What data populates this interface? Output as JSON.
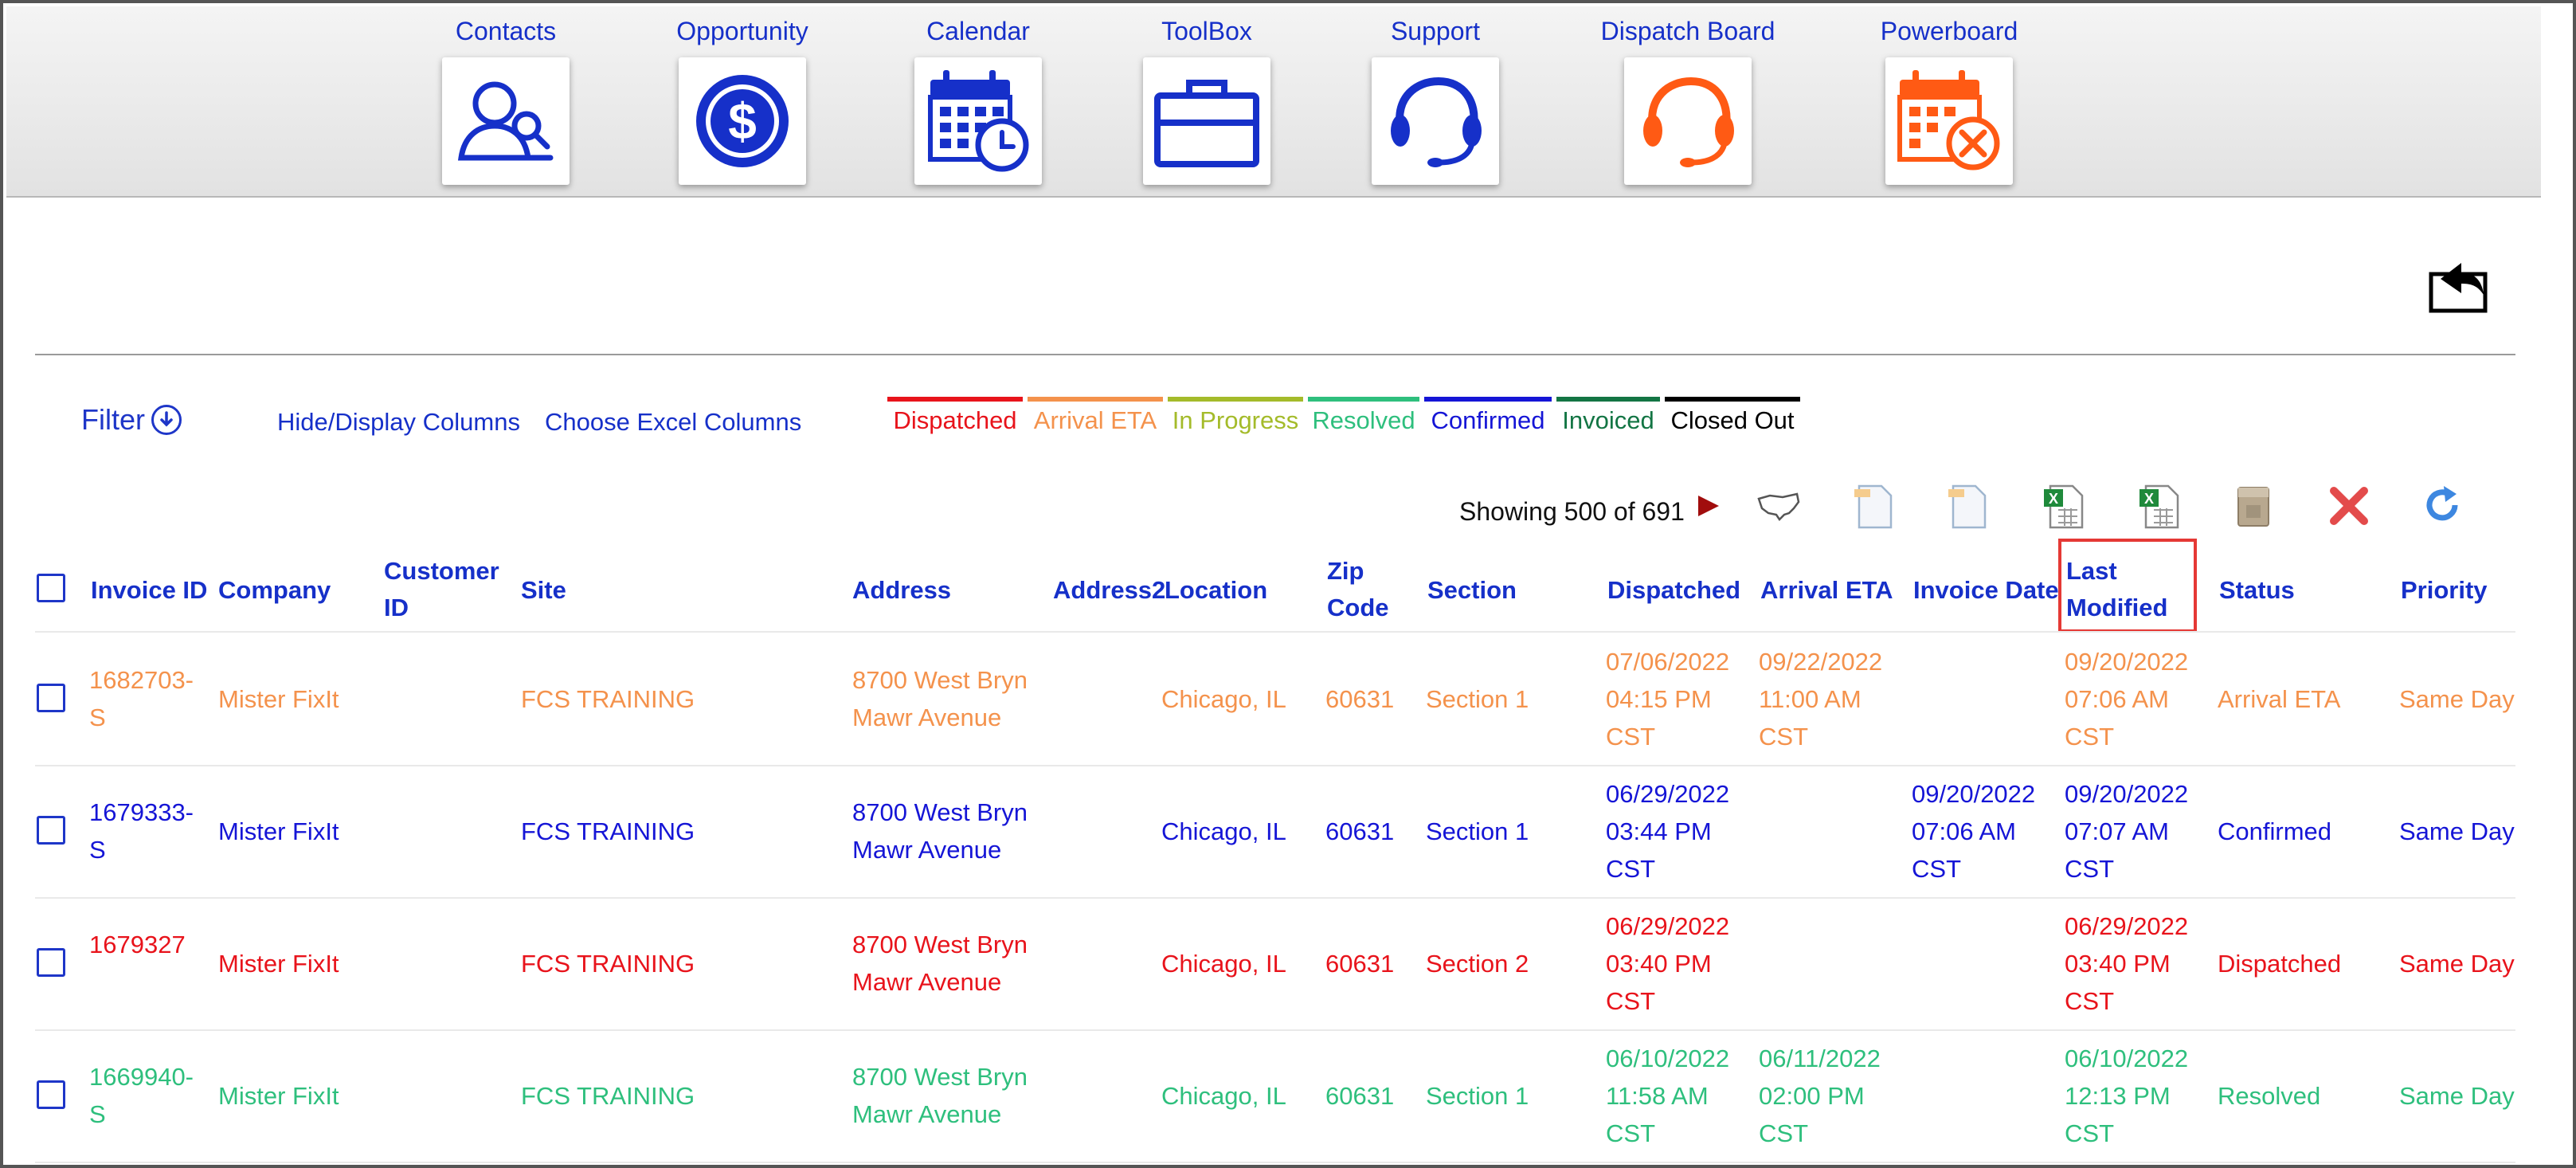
{
  "nav": [
    {
      "label": "Contacts",
      "icon": "contacts-icon",
      "color": "#1630c9"
    },
    {
      "label": "Opportunity",
      "icon": "dollar-icon",
      "color": "#1630c9"
    },
    {
      "label": "Calendar",
      "icon": "calendar-clock-icon",
      "color": "#1630c9"
    },
    {
      "label": "ToolBox",
      "icon": "briefcase-icon",
      "color": "#1630c9"
    },
    {
      "label": "Support",
      "icon": "headset-icon",
      "color": "#1630c9"
    },
    {
      "label": "Dispatch Board",
      "icon": "headset-orange-icon",
      "color": "#ff5a14"
    },
    {
      "label": "Powerboard",
      "icon": "calendar-tools-icon",
      "color": "#ff5a14"
    }
  ],
  "toolbar": {
    "filter_label": "Filter",
    "hide_display_columns": "Hide/Display Columns",
    "choose_excel_columns": "Choose Excel Columns",
    "showing_text": "Showing 500 of 691"
  },
  "legend": [
    {
      "label": "Dispatched",
      "color": "#e8131b"
    },
    {
      "label": "Arrival ETA",
      "color": "#f4924c"
    },
    {
      "label": "In Progress",
      "color": "#a4bb2a"
    },
    {
      "label": "Resolved",
      "color": "#2ebf7d"
    },
    {
      "label": "Confirmed",
      "color": "#1515d6"
    },
    {
      "label": "Invoiced",
      "color": "#137544"
    },
    {
      "label": "Closed Out",
      "color": "#000000"
    }
  ],
  "table": {
    "headers": {
      "invoice_id": "Invoice ID",
      "company": "Company",
      "customer_id": "Customer ID",
      "site": "Site",
      "address": "Address",
      "address2": "Address2",
      "location": "Location",
      "zip_code": "Zip Code",
      "section": "Section",
      "dispatched": "Dispatched",
      "arrival_eta": "Arrival ETA",
      "invoice_date": "Invoice Date",
      "last_modified": "Last Modified",
      "status": "Status",
      "priority": "Priority"
    },
    "rows": [
      {
        "color": "#f4924c",
        "invoice_id": "1682703-S",
        "company": "Mister FixIt",
        "customer_id": "",
        "site": "FCS TRAINING",
        "address": "8700 West Bryn Mawr Avenue",
        "address2": "",
        "location": "Chicago, IL",
        "zip_code": "60631",
        "section": "Section 1",
        "dispatched": "07/06/2022 04:15 PM CST",
        "arrival_eta": "09/22/2022 11:00 AM CST",
        "invoice_date": "",
        "last_modified": "09/20/2022 07:06 AM CST",
        "status": "Arrival ETA",
        "priority": "Same Day"
      },
      {
        "color": "#1515d6",
        "invoice_id": "1679333-S",
        "company": "Mister FixIt",
        "customer_id": "",
        "site": "FCS TRAINING",
        "address": "8700 West Bryn Mawr Avenue",
        "address2": "",
        "location": "Chicago, IL",
        "zip_code": "60631",
        "section": "Section 1",
        "dispatched": "06/29/2022 03:44 PM CST",
        "arrival_eta": "",
        "invoice_date": "09/20/2022 07:06 AM CST",
        "last_modified": "09/20/2022 07:07 AM CST",
        "status": "Confirmed",
        "priority": "Same Day"
      },
      {
        "color": "#e8131b",
        "invoice_id": "1679327",
        "company": "Mister FixIt",
        "customer_id": "",
        "site": "FCS TRAINING",
        "address": "8700 West Bryn Mawr Avenue",
        "address2": "",
        "location": "Chicago, IL",
        "zip_code": "60631",
        "section": "Section 2",
        "dispatched": "06/29/2022 03:40 PM CST",
        "arrival_eta": "",
        "invoice_date": "",
        "last_modified": "06/29/2022 03:40 PM CST",
        "status": "Dispatched",
        "priority": "Same Day"
      },
      {
        "color": "#2ebf7d",
        "invoice_id": "1669940-S",
        "company": "Mister FixIt",
        "customer_id": "",
        "site": "FCS TRAINING",
        "address": "8700 West Bryn Mawr Avenue",
        "address2": "",
        "location": "Chicago, IL",
        "zip_code": "60631",
        "section": "Section 1",
        "dispatched": "06/10/2022 11:58 AM CST",
        "arrival_eta": "06/11/2022 02:00 PM CST",
        "invoice_date": "",
        "last_modified": "06/10/2022 12:13 PM CST",
        "status": "Resolved",
        "priority": "Same Day"
      }
    ]
  }
}
